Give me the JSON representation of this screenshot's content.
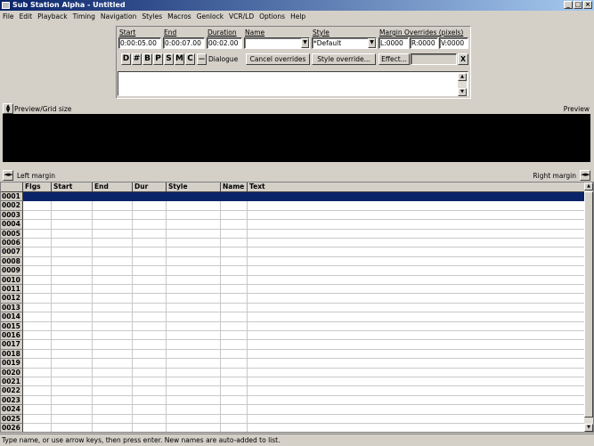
{
  "window": {
    "title": "Sub Station Alpha - Untitled"
  },
  "menu": [
    "File",
    "Edit",
    "Playback",
    "Timing",
    "Navigation",
    "Styles",
    "Macros",
    "Genlock",
    "VCR/LD",
    "Options",
    "Help"
  ],
  "fields": {
    "start_label": "Start",
    "start_value": "0:00:05.00",
    "end_label": "End",
    "end_value": "0:00:07.00",
    "duration_label": "Duration",
    "duration_value": "00:02.00",
    "name_label": "Name",
    "name_value": "",
    "style_label": "Style",
    "style_value": "*Default",
    "margin_label": "Margin Overrides (pixels)",
    "margin_l": "L:0000",
    "margin_r": "R:0000",
    "margin_v": "V:0000"
  },
  "type_buttons": [
    "D",
    "#",
    "B",
    "P",
    "S",
    "M",
    "C"
  ],
  "dash": "—",
  "dialogue_label": "Dialogue",
  "buttons": {
    "cancel_overrides": "Cancel overrides",
    "style_override": "Style override...",
    "effect": "Effect...",
    "close": "X"
  },
  "preview": {
    "label_left": "Preview/Grid size",
    "label_right": "Preview"
  },
  "margins": {
    "left": "Left margin",
    "right": "Right margin"
  },
  "grid": {
    "headers": [
      "Flgs",
      "Start",
      "End",
      "Dur",
      "Style",
      "Name",
      "Text"
    ],
    "rows": [
      "0001",
      "0002",
      "0003",
      "0004",
      "0005",
      "0006",
      "0007",
      "0008",
      "0009",
      "0010",
      "0011",
      "0012",
      "0013",
      "0014",
      "0015",
      "0016",
      "0017",
      "0018",
      "0019",
      "0020",
      "0021",
      "0022",
      "0023",
      "0024",
      "0025",
      "0026"
    ]
  },
  "status": "Type name, or use arrow keys, then press enter. New names are auto-added to list."
}
